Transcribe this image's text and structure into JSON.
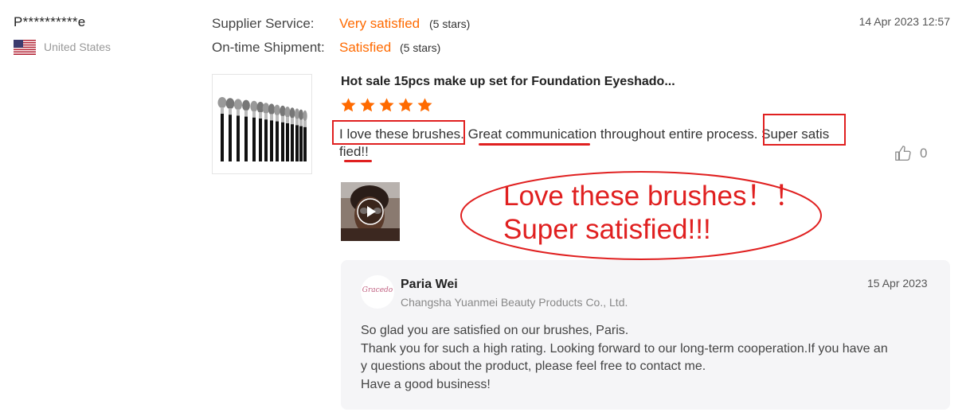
{
  "reviewer": {
    "name": "P**********e",
    "country": "United States",
    "flag_icon": "us-flag-icon"
  },
  "ratings": [
    {
      "label": "Supplier Service:",
      "value": "Very satisfied",
      "stars_text": "(5 stars)"
    },
    {
      "label": "On-time Shipment:",
      "value": "Satisfied",
      "stars_text": "(5 stars)"
    }
  ],
  "review_date": "14 Apr 2023 12:57",
  "product": {
    "title": "Hot sale 15pcs make up set for Foundation Eyeshado...",
    "star_rating": 5,
    "max_stars": 5
  },
  "review": {
    "line1_parts": [
      "I love these brushes.",
      " ",
      "Great communicat",
      "ion throughout entire process.",
      " ",
      "Super satis"
    ],
    "line2": "fied!!"
  },
  "likes": {
    "count": "0",
    "icon": "thumbs-up-icon"
  },
  "media": {
    "icon": "play-icon"
  },
  "callout": {
    "line1": "Love these brushes！！",
    "line2": "Super satisfied!!!"
  },
  "seller_reply": {
    "logo_text": "Gracedo",
    "name": "Paria Wei",
    "company": "Changsha Yuanmei Beauty Products Co., Ltd.",
    "date": "15 Apr 2023",
    "lines": [
      "So glad you are satisfied on our brushes, Paris.",
      "Thank you for such a high rating. Looking forward to our long-term cooperation.If you have an",
      "y questions about the product, please feel free to contact me.",
      "Have a good business!"
    ]
  },
  "colors": {
    "accent": "#ff6a00",
    "annotation": "#e02020",
    "reply_bg": "#f5f5f7"
  }
}
